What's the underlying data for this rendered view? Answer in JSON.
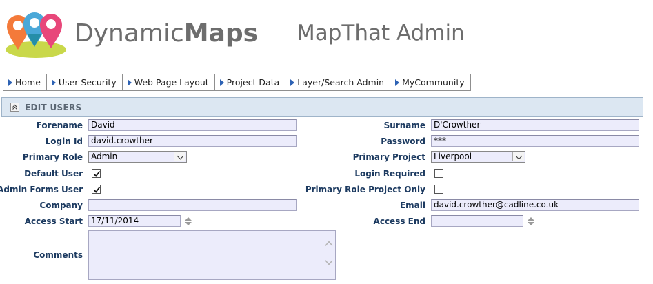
{
  "header": {
    "brand_light": "Dynamic",
    "brand_bold": "Maps",
    "app_title": "MapThat Admin"
  },
  "nav": {
    "items": [
      {
        "label": "Home"
      },
      {
        "label": "User Security"
      },
      {
        "label": "Web Page Layout"
      },
      {
        "label": "Project Data"
      },
      {
        "label": "Layer/Search Admin"
      },
      {
        "label": "MyCommunity"
      }
    ]
  },
  "section": {
    "title": "EDIT USERS"
  },
  "form": {
    "forename": {
      "label": "Forename",
      "value": "David"
    },
    "surname": {
      "label": "Surname",
      "value": "D'Crowther"
    },
    "login_id": {
      "label": "Login Id",
      "value": "david.crowther"
    },
    "password": {
      "label": "Password",
      "value": "***"
    },
    "primary_role": {
      "label": "Primary Role",
      "value": "Admin"
    },
    "primary_project": {
      "label": "Primary Project",
      "value": "Liverpool"
    },
    "default_user": {
      "label": "Default User",
      "checked": true
    },
    "login_required": {
      "label": "Login Required",
      "checked": false
    },
    "admin_forms_user": {
      "label": "Admin Forms User",
      "checked": true
    },
    "primary_role_project_only": {
      "label": "Primary Role Project Only",
      "checked": false
    },
    "company": {
      "label": "Company",
      "value": ""
    },
    "email": {
      "label": "Email",
      "value": "david.crowther@cadline.co.uk"
    },
    "access_start": {
      "label": "Access Start",
      "value": "17/11/2014"
    },
    "access_end": {
      "label": "Access End",
      "value": ""
    },
    "comments": {
      "label": "Comments",
      "value": ""
    }
  },
  "colors": {
    "pin_orange": "#f47a3a",
    "pin_blue": "#4aa8d8",
    "pin_pink": "#e8477a",
    "pin_teal": "#1e8aa0",
    "pin_base_green": "#c9d84a",
    "nav_arrow": "#2d62b4",
    "label_text": "#1c3a60",
    "field_bg": "#ececfb",
    "section_bg": "#dce7f2"
  }
}
